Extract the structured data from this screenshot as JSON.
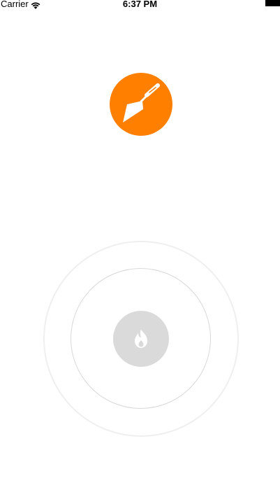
{
  "status_bar": {
    "carrier": "Carrier",
    "time": "6:37 PM",
    "wifi_icon": "wifi-icon",
    "battery_icon": "battery-icon"
  },
  "logo": {
    "icon": "trowel-icon",
    "color": "#ff7f00"
  },
  "radar": {
    "outer_ring_color": "#efefef",
    "inner_ring_color": "#d8d8d8",
    "center_button_color": "#dadada",
    "center_icon": "flame-icon"
  }
}
